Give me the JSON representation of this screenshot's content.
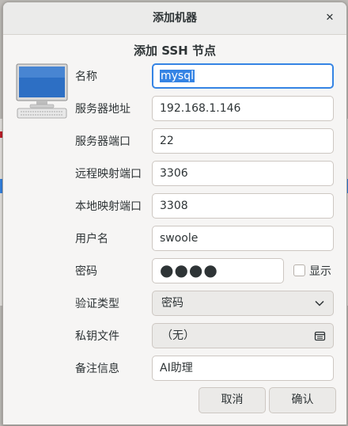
{
  "window": {
    "title": "添加机器"
  },
  "heading": "添加 SSH 节点",
  "form": {
    "name": {
      "label": "名称",
      "value": "mysql"
    },
    "host": {
      "label": "服务器地址",
      "value": "192.168.1.146"
    },
    "port": {
      "label": "服务器端口",
      "value": "22"
    },
    "remote_port": {
      "label": "远程映射端口",
      "value": "3306"
    },
    "local_port": {
      "label": "本地映射端口",
      "value": "3308"
    },
    "username": {
      "label": "用户名",
      "value": "swoole"
    },
    "password": {
      "label": "密码",
      "masked_value": "●●●●",
      "show_label": "显示"
    },
    "auth_type": {
      "label": "验证类型",
      "selected": "密码"
    },
    "key_file": {
      "label": "私钥文件",
      "value": "（无）"
    },
    "note": {
      "label": "备注信息",
      "value": "AI助理"
    }
  },
  "buttons": {
    "cancel": "取消",
    "confirm": "确认"
  },
  "icons": {
    "close": "close-icon",
    "computer": "computer-icon",
    "dropdown": "chevron-down-icon",
    "file": "file-open-icon"
  },
  "colors": {
    "accent": "#3584e4",
    "window_bg": "#f6f5f4"
  }
}
